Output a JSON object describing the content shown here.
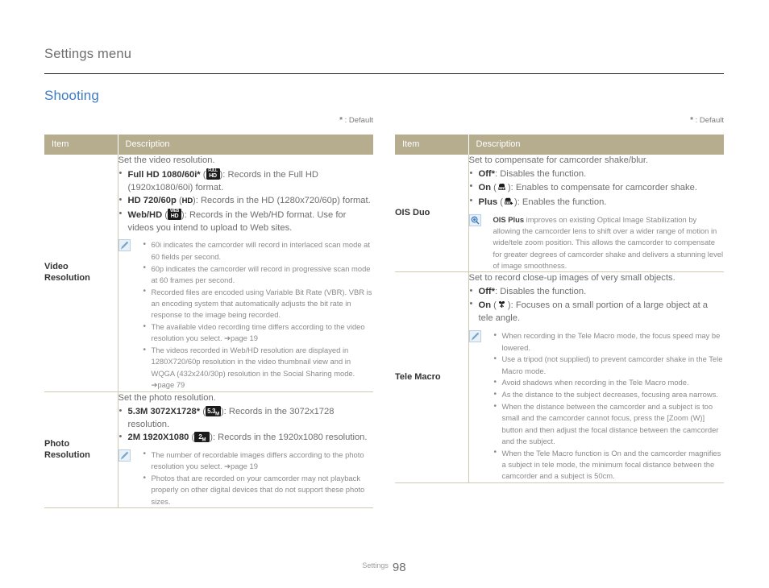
{
  "header": {
    "title": "Settings menu",
    "section": "Shooting"
  },
  "default_note": {
    "star": "*",
    "text": " : Default"
  },
  "columns": {
    "item": "Item",
    "description": "Description"
  },
  "footer": {
    "label": "Settings",
    "page": "98"
  },
  "colors": {
    "table_header_bg": "#b5ad8e",
    "section_title": "#3c7cc4",
    "body_text": "#6d6e70",
    "rule": "#231f20",
    "note_icon_bg": "#e8f0f8"
  },
  "left_table": {
    "rows": [
      {
        "item": "Video Resolution",
        "item_line1": "Video",
        "item_line2": "Resolution",
        "lead": "Set the video resolution.",
        "bullets": [
          {
            "bold": "Full HD 1080/60i*",
            "icon": "full-hd-icon",
            "rest": "): Records in the Full HD (1920x1080/60i) format."
          },
          {
            "bold": "HD 720/60p",
            "icon": "hd-icon",
            "rest": "): Records in the HD (1280x720/60p) format."
          },
          {
            "bold": "Web/HD",
            "icon": "web-hd-icon",
            "rest": "): Records in the Web/HD format. Use for videos you intend to upload to Web sites."
          }
        ],
        "note": {
          "icon": "note-pencil-icon",
          "items": [
            "60i indicates the camcorder will record in interlaced scan mode at 60 fields per second.",
            "60p indicates the camcorder will record in progressive scan mode at 60 frames per second.",
            "Recorded files are encoded using Variable Bit Rate (VBR). VBR is an encoding system that automatically adjusts the bit rate in response to the image being recorded.",
            "The available video recording time differs according to the video resolution you select. ➔page 19",
            "The videos recorded in Web/HD resolution are displayed in 1280X720/60p resolution in the video thumbnail view and in WQGA (432x240/30p) resolution in the Social Sharing mode. ➔page 79"
          ]
        }
      },
      {
        "item": "Photo Resolution",
        "item_line1": "Photo",
        "item_line2": "Resolution",
        "lead": "Set the photo resolution.",
        "bullets": [
          {
            "bold": "5.3M 3072X1728*",
            "icon": "res-53m-icon",
            "rest": "): Records in the 3072x1728 resolution."
          },
          {
            "bold": "2M 1920X1080",
            "icon": "res-2m-icon",
            "rest": "): Records in the 1920x1080 resolution."
          }
        ],
        "note": {
          "icon": "note-pencil-icon",
          "items": [
            "The number of recordable images differs according to the photo resolution you select. ➔page 19",
            "Photos that are recorded on your camcorder may not playback properly on other digital devices that do not support these photo sizes."
          ]
        }
      }
    ]
  },
  "right_table": {
    "rows": [
      {
        "item": "OIS Duo",
        "item_line1": "OIS Duo",
        "item_line2": "",
        "lead": "Set to compensate for camcorder shake/blur.",
        "bullets": [
          {
            "bold": "Off*",
            "icon": "",
            "rest": ": Disables the function."
          },
          {
            "bold": "On",
            "icon": "ois-on-icon",
            "rest": "): Enables to compensate for camcorder shake."
          },
          {
            "bold": "Plus",
            "icon": "ois-plus-icon",
            "rest": "): Enables the function."
          }
        ],
        "note": {
          "icon": "note-info-icon",
          "bold_lead": "OIS Plus",
          "paragraph": " improves on existing Optical Image Stabilization by allowing the camcorder lens to shift over a wider range of motion in wide/tele zoom position. This allows the camcorder to compensate for greater degrees of camcorder shake and delivers a stunning level of image smoothness."
        }
      },
      {
        "item": "Tele Macro",
        "item_line1": "Tele Macro",
        "item_line2": "",
        "lead": "Set to record close-up images of very small objects.",
        "bullets": [
          {
            "bold": "Off*",
            "icon": "",
            "rest": ": Disables the function."
          },
          {
            "bold": "On",
            "icon": "tele-macro-icon",
            "rest": "): Focuses on a small portion of a large object at a tele angle."
          }
        ],
        "note": {
          "icon": "note-pencil-icon",
          "items": [
            "When recording in the Tele Macro mode, the focus speed may be lowered.",
            "Use a tripod (not supplied) to prevent camcorder shake in the Tele Macro mode.",
            "Avoid shadows when recording in the Tele Macro mode.",
            "As the distance to the subject decreases, focusing area narrows.",
            "When the distance between the camcorder and a subject is too small and the camcorder cannot focus, press the [Zoom (W)] button and then adjust the focal distance between the camcorder and the subject.",
            "When the Tele Macro function is On and the camcorder magnifies a subject in tele mode, the minimum focal distance between the camcorder and a subject is 50cm."
          ]
        }
      }
    ]
  }
}
